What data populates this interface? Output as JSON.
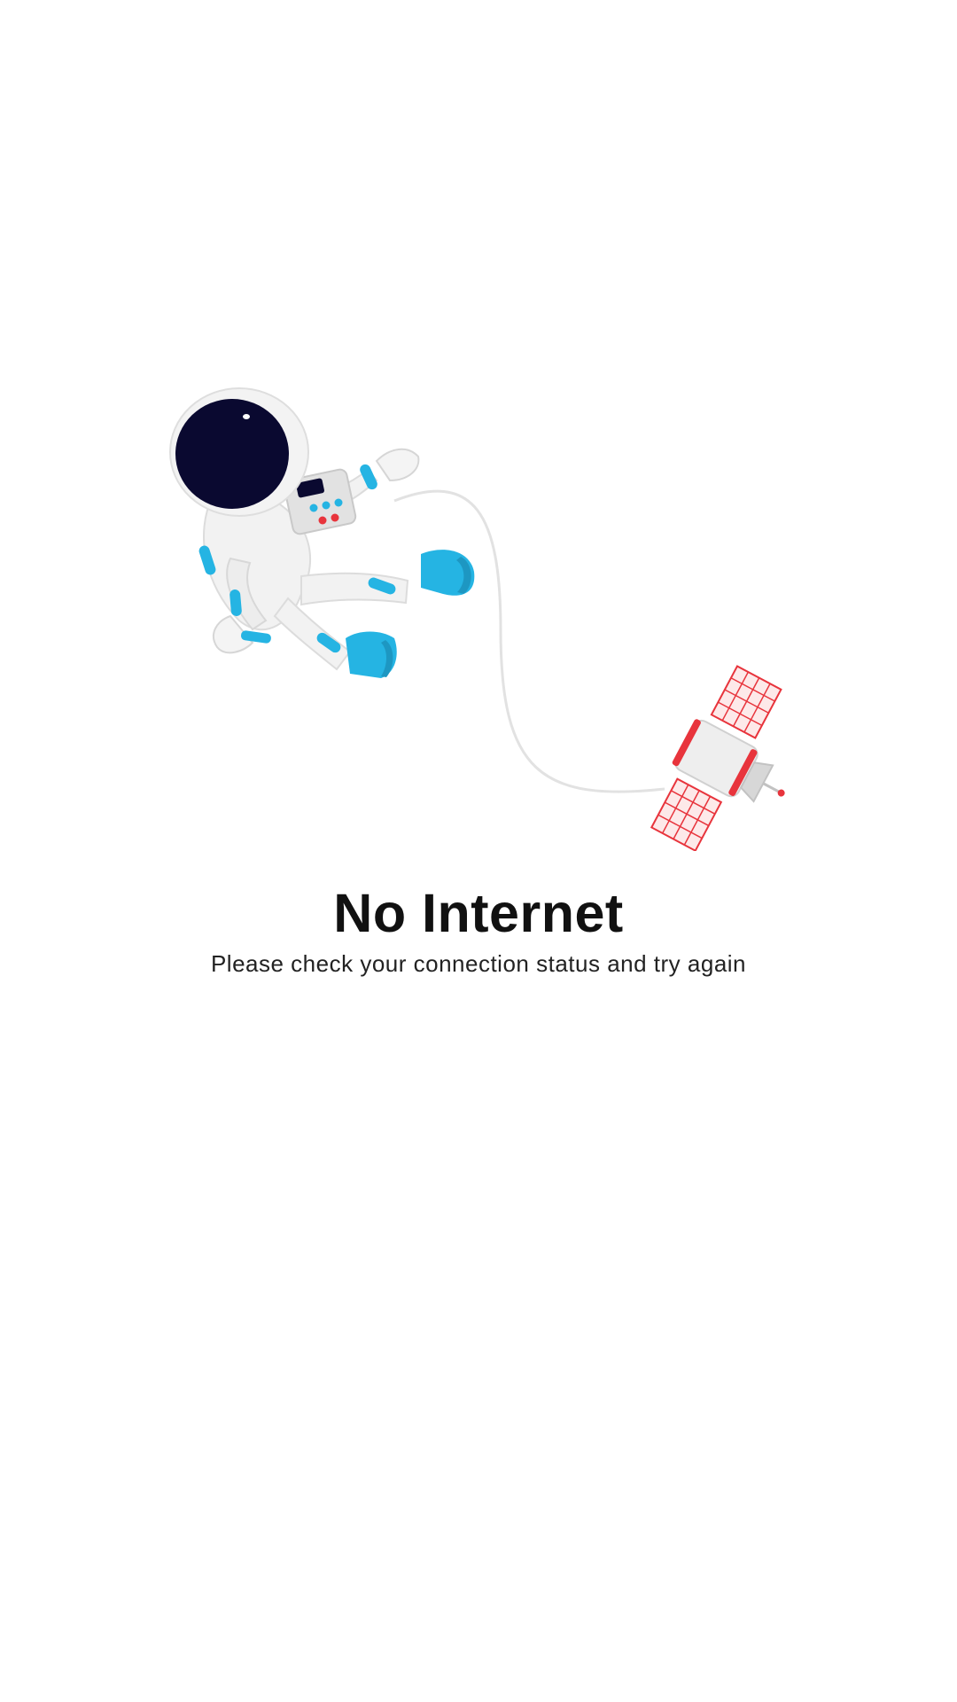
{
  "empty_state": {
    "title": "No Internet",
    "message": "Please check your connection status and try again",
    "illustration": {
      "subject": "astronaut-tethered-to-satellite",
      "colors": {
        "helmet_visor": "#0a0930",
        "suit": "#f1f1f1",
        "accent_blue": "#25b4e3",
        "accent_red": "#e8343c",
        "tether": "#e2e2e2"
      }
    }
  }
}
